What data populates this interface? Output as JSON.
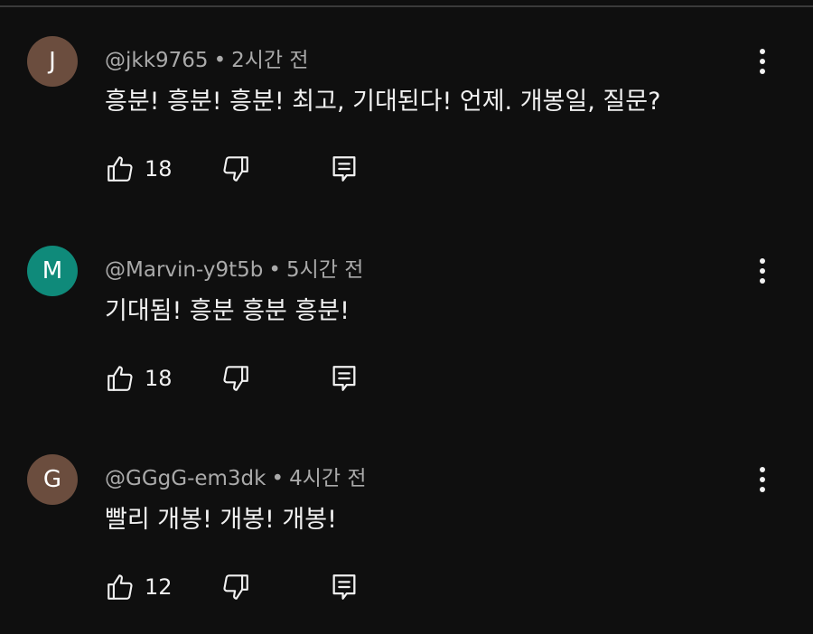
{
  "comments": [
    {
      "avatar_letter": "J",
      "avatar_color": "#6b4d3e",
      "handle": "@jkk9765",
      "separator": "•",
      "time": "2시간 전",
      "text": "흥분! 흥분! 흥분! 최고, 기대된다! 언제. 개봉일, 질문?",
      "likes": "18"
    },
    {
      "avatar_letter": "M",
      "avatar_color": "#0f8a7a",
      "handle": "@Marvin-y9t5b",
      "separator": "•",
      "time": "5시간 전",
      "text": "기대됨! 흥분 흥분 흥분!",
      "likes": "18"
    },
    {
      "avatar_letter": "G",
      "avatar_color": "#6b4d3e",
      "handle": "@GGgG-em3dk",
      "separator": "•",
      "time": "4시간 전",
      "text": "빨리 개봉! 개봉! 개봉!",
      "likes": "12"
    }
  ],
  "icons": {
    "like": "thumbs-up-icon",
    "dislike": "thumbs-down-icon",
    "reply": "reply-icon",
    "menu": "more-vertical-icon"
  }
}
